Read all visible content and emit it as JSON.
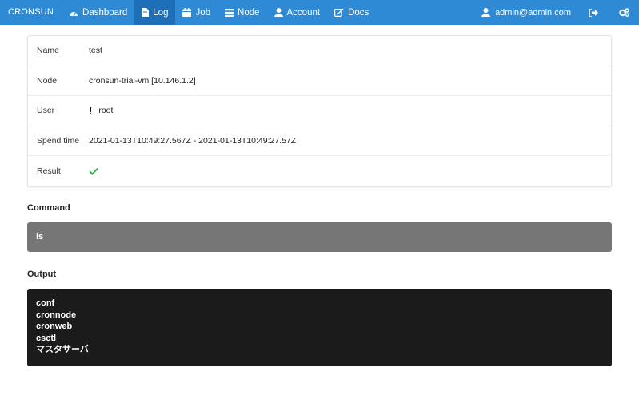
{
  "nav": {
    "brand": "CRONSUN",
    "items": [
      {
        "label": "Dashboard",
        "icon": "dashboard-icon"
      },
      {
        "label": "Log",
        "icon": "file-icon",
        "active": true
      },
      {
        "label": "Job",
        "icon": "calendar-icon"
      },
      {
        "label": "Node",
        "icon": "list-icon"
      },
      {
        "label": "Account",
        "icon": "user-icon"
      },
      {
        "label": "Docs",
        "icon": "edit-icon"
      }
    ],
    "user": "admin@admin.com",
    "logout_icon": "sign-out-icon",
    "settings_icon": "settings-icon",
    "colors": {
      "bar": "#2f8ad6",
      "active": "#1f6fb8"
    }
  },
  "details": {
    "rows": [
      {
        "key": "Name",
        "value": "test"
      },
      {
        "key": "Node",
        "value": "cronsun-trial-vm [10.146.1.2]"
      },
      {
        "key": "User",
        "value": "root",
        "icon": "exclamation-icon"
      },
      {
        "key": "Spend time",
        "value": "2021-01-13T10:49:27.567Z - 2021-01-13T10:49:27.57Z"
      },
      {
        "key": "Result",
        "icon": "check-icon",
        "status_color": "#21ba45"
      }
    ]
  },
  "command": {
    "title": "Command",
    "text": "ls"
  },
  "output": {
    "title": "Output",
    "lines": [
      "conf",
      "cronnode",
      "cronweb",
      "csctl",
      "マスタサーバ"
    ]
  }
}
